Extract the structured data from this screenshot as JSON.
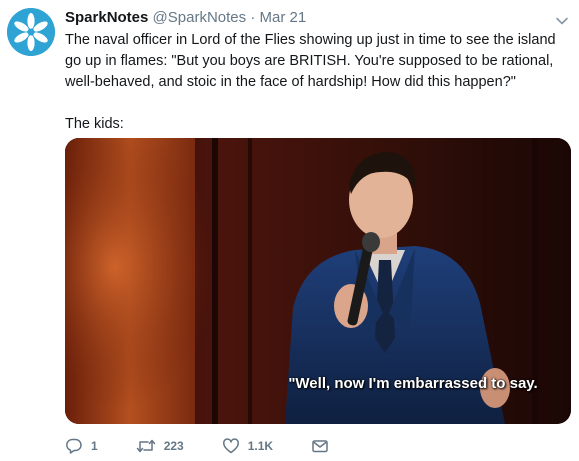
{
  "author": {
    "name": "SparkNotes",
    "handle": "@SparkNotes",
    "separator": "·",
    "date": "Mar 21"
  },
  "tweet": {
    "body": "The naval officer in Lord of the Flies showing up just in time to see the island go up in flames: \"But you boys are BRITISH. You're supposed to be rational, well-behaved, and stoic in the face of hardship! How did this happen?\"\n\nThe kids:"
  },
  "media": {
    "subtitle": "\"Well, now I'm embarrassed to say."
  },
  "actions": {
    "reply_count": "1",
    "retweet_count": "223",
    "like_count": "1.1K"
  },
  "colors": {
    "brand": "#2fa3d4",
    "muted": "#657786"
  }
}
